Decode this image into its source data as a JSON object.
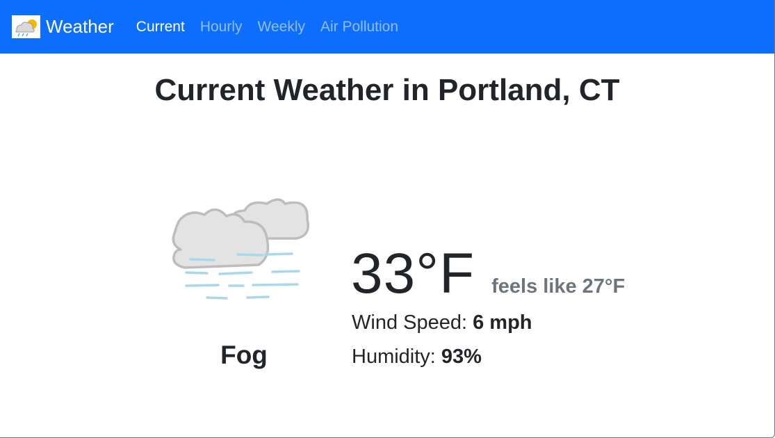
{
  "navbar": {
    "brand": "Weather",
    "brand_icon": "weather-logo-icon",
    "links": [
      {
        "label": "Current",
        "active": true
      },
      {
        "label": "Hourly",
        "active": false
      },
      {
        "label": "Weekly",
        "active": false
      },
      {
        "label": "Air Pollution",
        "active": false
      }
    ],
    "color": "#0d6efd"
  },
  "page": {
    "title": "Current Weather in Portland, CT"
  },
  "weather": {
    "icon": "fog-icon",
    "condition": "Fog",
    "temperature": "33°F",
    "feels_like": "feels like 27°F",
    "wind_label": "Wind Speed:",
    "wind_value": "6 mph",
    "humidity_label": "Humidity:",
    "humidity_value": "93%"
  }
}
